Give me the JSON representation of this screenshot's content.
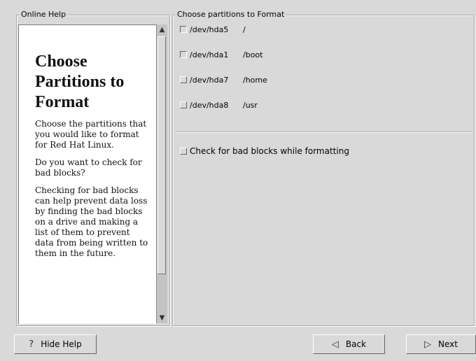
{
  "help": {
    "frame_label": "Online Help",
    "title": "Choose Partitions to Format",
    "paragraphs": [
      "Choose the partitions that you would like to format for Red Hat Linux.",
      "Do you want to check for bad blocks?",
      "Checking for bad blocks can help prevent data loss by finding the bad blocks on a drive and making a list of them to prevent data from being written to them in the future."
    ]
  },
  "format": {
    "frame_label": "Choose partitions to Format",
    "partitions": [
      {
        "device": "/dev/hda5",
        "mount": "/",
        "checked": true
      },
      {
        "device": "/dev/hda1",
        "mount": "/boot",
        "checked": true
      },
      {
        "device": "/dev/hda7",
        "mount": "/home",
        "checked": false
      },
      {
        "device": "/dev/hda8",
        "mount": "/usr",
        "checked": false
      }
    ],
    "bad_blocks": {
      "label": "Check for bad blocks while formatting",
      "checked": false
    }
  },
  "buttons": {
    "hide_help": "Hide Help",
    "back": "Back",
    "next": "Next"
  },
  "icons": {
    "hide_help": "question-mark-icon",
    "back": "back-arrow-icon",
    "next": "next-arrow-icon"
  }
}
